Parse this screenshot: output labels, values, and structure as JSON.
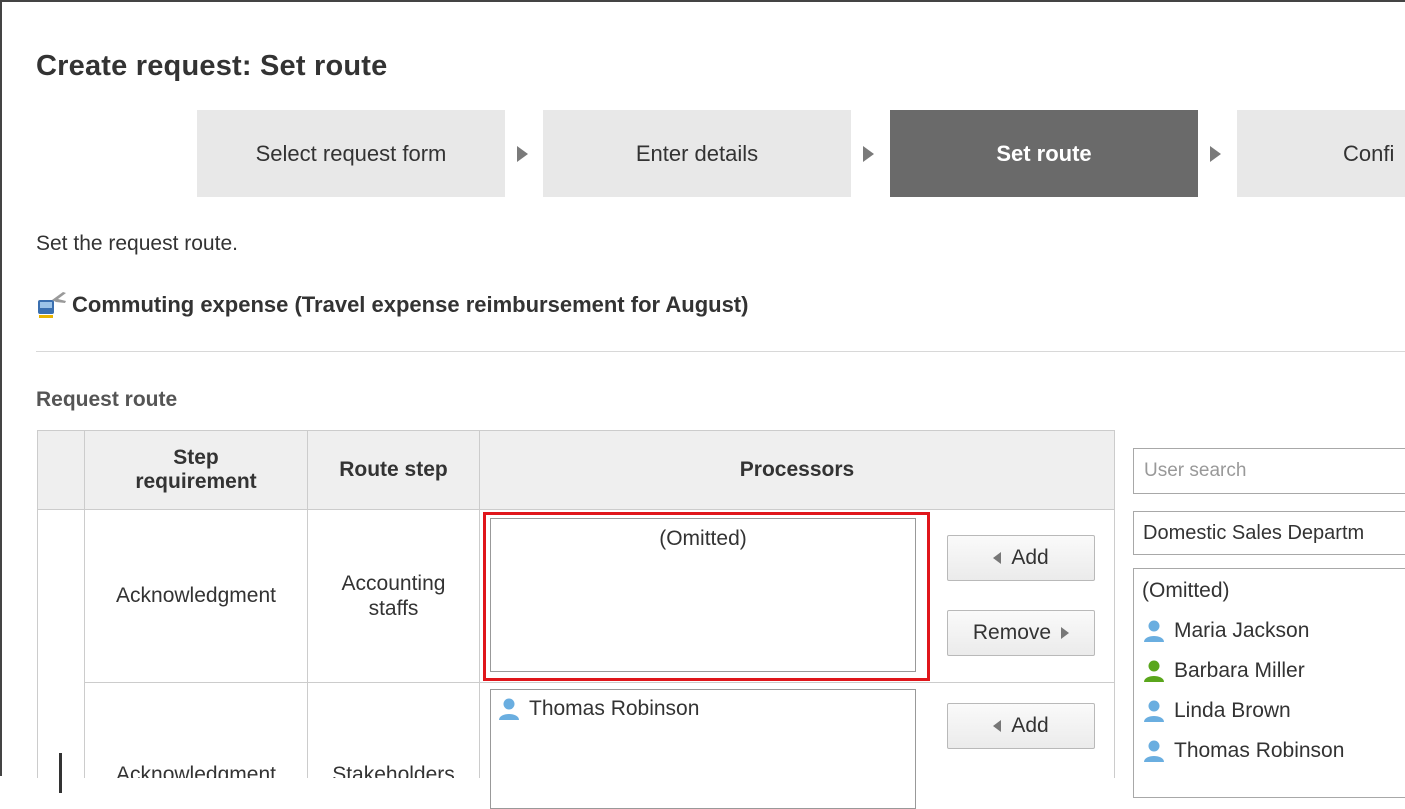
{
  "page": {
    "title": "Create request: Set route",
    "instruction": "Set the request route.",
    "form_title": "Commuting expense (Travel expense reimbursement for August)",
    "section_label": "Request route"
  },
  "steps": [
    {
      "label": "Select request form",
      "active": false
    },
    {
      "label": "Enter details",
      "active": false
    },
    {
      "label": "Set route",
      "active": true
    },
    {
      "label": "Confi",
      "active": false
    }
  ],
  "table": {
    "headers": {
      "requirement": "Step\nrequirement",
      "route_step": "Route step",
      "processors": "Processors"
    },
    "rows": [
      {
        "requirement": "Acknowledgment",
        "route_step": "Accounting\nstaffs",
        "processors": [
          {
            "name": "(Omitted)",
            "icon": "none"
          }
        ],
        "add_label": "Add",
        "remove_label": "Remove"
      },
      {
        "requirement": "Acknowledgment",
        "route_step": "Stakeholders",
        "processors": [
          {
            "name": "Thomas Robinson",
            "icon": "user-icon"
          }
        ],
        "add_label": "Add"
      }
    ]
  },
  "right_panel": {
    "search_placeholder": "User search",
    "department": "Domestic Sales Departm",
    "users": [
      {
        "name": "(Omitted)",
        "icon": "none"
      },
      {
        "name": "Maria Jackson",
        "icon": "user-icon",
        "color": "#6aaee0"
      },
      {
        "name": "Barbara Miller",
        "icon": "user-icon",
        "color": "#5aa61c"
      },
      {
        "name": "Linda Brown",
        "icon": "user-icon",
        "color": "#6aaee0"
      },
      {
        "name": "Thomas Robinson",
        "icon": "user-icon",
        "color": "#6aaee0"
      }
    ]
  },
  "colors": {
    "active_step": "#6a6a6a",
    "highlight": "#e0161b",
    "user_blue": "#6aaee0",
    "user_green": "#5aa61c"
  }
}
